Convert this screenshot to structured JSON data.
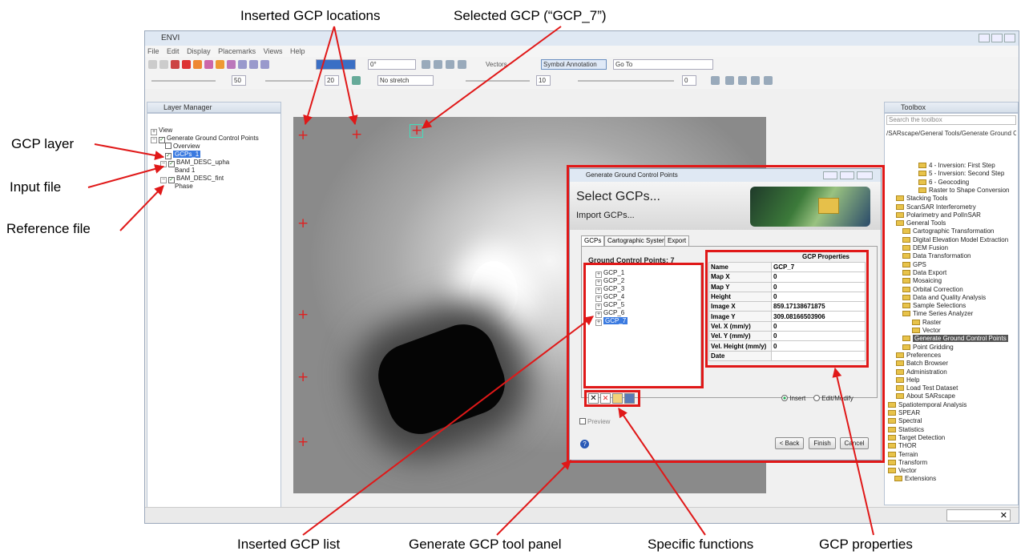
{
  "callouts": {
    "inserted_locations": "Inserted GCP locations",
    "selected_gcp": "Selected GCP (“GCP_7”)",
    "gcp_layer": "GCP layer",
    "input_file": "Input file",
    "reference_file": "Reference file",
    "inserted_list": "Inserted GCP list",
    "tool_panel": "Generate GCP tool panel",
    "specific_functions": "Specific functions",
    "gcp_properties": "GCP properties"
  },
  "app": {
    "title": "ENVI",
    "menu": [
      "File",
      "Edit",
      "Display",
      "Placemarks",
      "Views",
      "Help"
    ]
  },
  "toolbar": {
    "rotation": "0°",
    "vectors": "Vectors",
    "symbol_annotation": "Symbol Annotation",
    "goto_label": "Go To",
    "stretch": "No stretch",
    "val_50": "50",
    "val_20": "20",
    "val_10": "10",
    "val_0": "0"
  },
  "layer_manager": {
    "title": "Layer Manager",
    "items": [
      "View",
      "Generate Ground Control Points",
      "Overview",
      "GCPs_1",
      "BAM_DESC_upha",
      "Band 1",
      "BAM_DESC_fint",
      "Phase"
    ]
  },
  "toolbox": {
    "title": "Toolbox",
    "search_placeholder": "Search the toolbox",
    "path": "/SARscape/General Tools/Generate Ground Cont",
    "items": [
      "4 - Inversion: First Step",
      "5 - Inversion: Second Step",
      "6 - Geocoding",
      "Raster to Shape Conversion",
      "Stacking Tools",
      "ScanSAR Interferometry",
      "Polarimetry and PolInSAR",
      "General Tools",
      "Cartographic Transformation",
      "Digital Elevation Model Extraction",
      "DEM Fusion",
      "Data Transformation",
      "GPS",
      "Data Export",
      "Mosaicing",
      "Orbital Correction",
      "Data and Quality Analysis",
      "Sample Selections",
      "Time Series Analyzer",
      "Raster",
      "Vector",
      "Generate Ground Control Points",
      "Point Gridding",
      "Preferences",
      "Batch Browser",
      "Administration",
      "Help",
      "Load Test Dataset",
      "About SARscape",
      "Spatiotemporal Analysis",
      "SPEAR",
      "Spectral",
      "Statistics",
      "Target Detection",
      "THOR",
      "Terrain",
      "Transform",
      "Vector",
      "Extensions"
    ]
  },
  "dialog": {
    "title": "Generate Ground Control Points",
    "heading": "Select GCPs...",
    "subheading": "Import GCPs...",
    "tabs": [
      "GCPs",
      "Cartographic System",
      "Export"
    ],
    "gcp_count_label": "Ground Control Points: 7",
    "gcps": [
      "GCP_1",
      "GCP_2",
      "GCP_3",
      "GCP_4",
      "GCP_5",
      "GCP_6",
      "GCP_7"
    ],
    "props_title": "GCP Properties",
    "props": [
      {
        "k": "Name",
        "v": "GCP_7"
      },
      {
        "k": "Map X",
        "v": "0"
      },
      {
        "k": "Map Y",
        "v": "0"
      },
      {
        "k": "Height",
        "v": "0"
      },
      {
        "k": "Image X",
        "v": "859.17138671875"
      },
      {
        "k": "Image Y",
        "v": "309.08166503906"
      },
      {
        "k": "Vel. X (mm/y)",
        "v": "0"
      },
      {
        "k": "Vel. Y (mm/y)",
        "v": "0"
      },
      {
        "k": "Vel. Height (mm/y)",
        "v": "0"
      },
      {
        "k": "Date",
        "v": ""
      }
    ],
    "insert_label": "Insert",
    "edit_label": "Edit/Modify",
    "preview_label": "Preview",
    "back": "< Back",
    "finish": "Finish",
    "cancel": "Cancel"
  }
}
